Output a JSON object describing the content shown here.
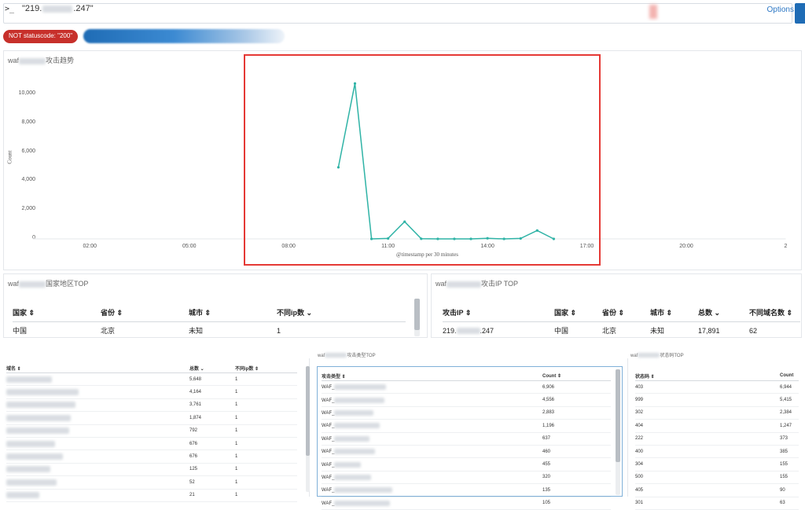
{
  "query": {
    "prompt": ">_",
    "text": "\"219.",
    "text_tail": ".247\"",
    "options_label": "Options"
  },
  "filters": [
    {
      "label": "NOT statuscode: \"200\""
    }
  ],
  "chart_panel": {
    "title_prefix": "waf",
    "title_suffix": "攻击趋势"
  },
  "chart_data": {
    "type": "line",
    "ylabel": "Count",
    "xlabel": "@timestamp per 30 minutes",
    "yticks": [
      "0",
      "2,000",
      "4,000",
      "6,000",
      "8,000",
      "10,000"
    ],
    "ytick_values": [
      0,
      2000,
      4000,
      6000,
      8000,
      10000
    ],
    "xticks": [
      "02:00",
      "05:00",
      "08:00",
      "11:00",
      "14:00",
      "17:00",
      "20:00",
      "2"
    ],
    "xtick_hours": [
      2,
      5,
      8,
      11,
      14,
      17,
      20,
      23
    ],
    "x_range_hours": [
      0,
      23
    ],
    "ylim": [
      0,
      11000
    ],
    "series": [
      {
        "color": "#2fb3a6",
        "x_hours": [
          9.5,
          10.0,
          10.5,
          11.0,
          11.5,
          12.0,
          12.5,
          13.0,
          13.5,
          14.0,
          14.5,
          15.0,
          15.5,
          16.0
        ],
        "values": [
          4950,
          10750,
          0,
          30,
          1190,
          10,
          0,
          0,
          0,
          40,
          0,
          30,
          580,
          0
        ]
      }
    ]
  },
  "region_panel": {
    "title_prefix": "waf",
    "title_suffix": "国家地区TOP",
    "headers": [
      "国家 ⇕",
      "省份 ⇕",
      "城市 ⇕",
      "不同ip数 ⌄"
    ],
    "rows": [
      [
        "中国",
        "北京",
        "未知",
        "1"
      ]
    ]
  },
  "ip_panel": {
    "title_prefix": "waf",
    "title_suffix": "攻击IP TOP",
    "headers": [
      "攻击IP ⇕",
      "国家 ⇕",
      "省份 ⇕",
      "城市 ⇕",
      "总数 ⌄",
      "不同域名数 ⇕"
    ],
    "row": {
      "ip_head": "219.",
      "ip_tail": ".247",
      "country": "中国",
      "province": "北京",
      "city": "未知",
      "total": "17,891",
      "domains": "62"
    }
  },
  "domain_panel": {
    "headers": [
      "域名 ⇕",
      "总数 ⌄",
      "不同ip数 ⇕"
    ],
    "rows": [
      [
        "5,648",
        "1"
      ],
      [
        "4,164",
        "1"
      ],
      [
        "3,761",
        "1"
      ],
      [
        "1,874",
        "1"
      ],
      [
        "792",
        "1"
      ],
      [
        "676",
        "1"
      ],
      [
        "676",
        "1"
      ],
      [
        "125",
        "1"
      ],
      [
        "52",
        "1"
      ],
      [
        "21",
        "1"
      ]
    ]
  },
  "attack_type_panel": {
    "title_prefix": "waf",
    "title_suffix": "攻击类型TOP",
    "headers": [
      "攻击类型 ⇕",
      "Count ⇕"
    ],
    "row_prefix": "WAF_",
    "rows": [
      "6,906",
      "4,556",
      "2,883",
      "1,196",
      "637",
      "460",
      "455",
      "320",
      "135",
      "105"
    ]
  },
  "status_panel": {
    "title_prefix": "waf",
    "title_suffix": "状态码TOP",
    "headers": [
      "状态码 ⇕",
      "Count"
    ],
    "rows": [
      [
        "403",
        "6,944"
      ],
      [
        "999",
        "5,415"
      ],
      [
        "302",
        "2,384"
      ],
      [
        "404",
        "1,247"
      ],
      [
        "222",
        "373"
      ],
      [
        "400",
        "385"
      ],
      [
        "304",
        "155"
      ],
      [
        "500",
        "155"
      ],
      [
        "405",
        "90"
      ],
      [
        "301",
        "63"
      ]
    ]
  },
  "colors": {
    "accent": "#1f6cb5",
    "filter_pill": "#c7302b",
    "line": "#2fb3a6",
    "highlight": "#e53935"
  }
}
